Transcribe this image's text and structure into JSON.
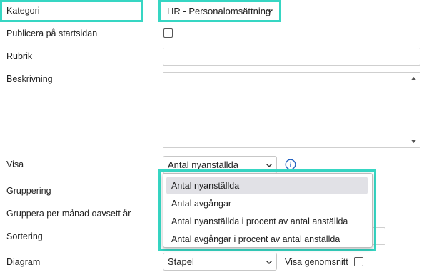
{
  "form": {
    "kategori": {
      "label": "Kategori",
      "value": "HR - Personalomsättning"
    },
    "publicera": {
      "label": "Publicera på startsidan",
      "checked": false
    },
    "rubrik": {
      "label": "Rubrik",
      "value": ""
    },
    "beskrivning": {
      "label": "Beskrivning",
      "value": ""
    },
    "visa": {
      "label": "Visa",
      "value": "Antal nyanställda",
      "info_icon": "info-icon",
      "options": [
        "Antal nyanställda",
        "Antal avgångar",
        "Antal nyanställda i procent av antal anställda",
        "Antal avgångar i procent av antal anställda"
      ],
      "selected_index": 0
    },
    "gruppering": {
      "label": "Gruppering"
    },
    "gruppera_per_manad": {
      "label": "Gruppera per månad oavsett år"
    },
    "sortering": {
      "label": "Sortering"
    },
    "diagram": {
      "label": "Diagram",
      "value": "Stapel"
    },
    "visa_genomsnitt": {
      "label": "Visa genomsnitt",
      "checked": false
    }
  },
  "colors": {
    "highlight": "#36d6c3",
    "info_icon": "#1f5fbf",
    "selected_option_bg": "#e1e1e6"
  }
}
